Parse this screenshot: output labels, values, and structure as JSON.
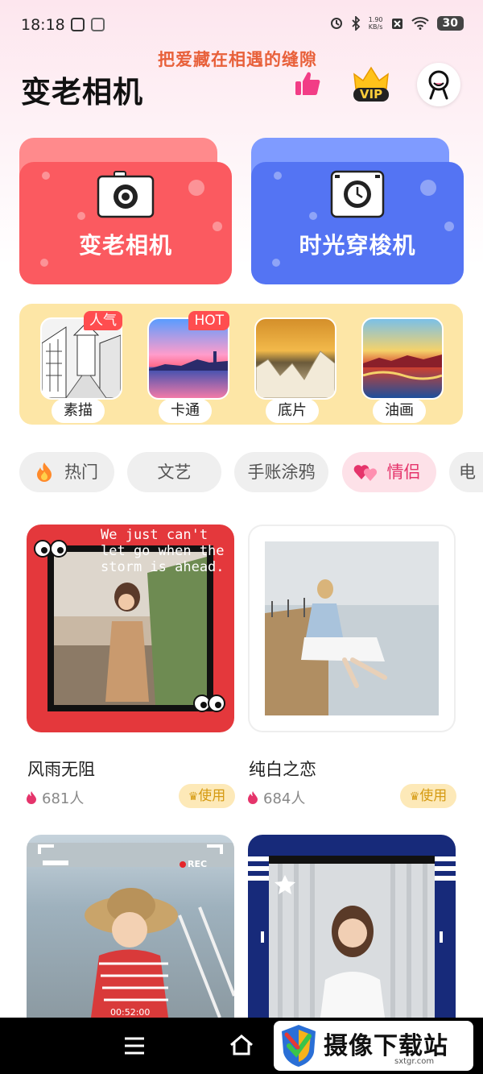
{
  "status_bar": {
    "time": "18:18",
    "net_speed_value": "1.90",
    "net_speed_unit": "KB/s",
    "battery": "30",
    "icons": [
      "alarm-icon",
      "bluetooth-icon",
      "sim-off-icon",
      "wifi-icon",
      "battery-icon"
    ]
  },
  "header": {
    "slogan": "把爱藏在相遇的缝隙",
    "title": "变老相机",
    "vip_label": "VIP"
  },
  "big_cards": [
    {
      "label": "变老相机",
      "color": "#fb5a60",
      "icon": "camera-icon"
    },
    {
      "label": "时光穿梭机",
      "color": "#5474f3",
      "icon": "clock-camera-icon"
    }
  ],
  "filters": [
    {
      "label": "素描",
      "badge": "人气"
    },
    {
      "label": "卡通",
      "badge": "HOT"
    },
    {
      "label": "底片",
      "badge": ""
    },
    {
      "label": "油画",
      "badge": ""
    }
  ],
  "categories": [
    {
      "label": "热门",
      "icon": "flame-icon"
    },
    {
      "label": "文艺"
    },
    {
      "label": "手账涂鸦"
    },
    {
      "label": "情侣",
      "icon": "hearts-icon",
      "selected": true
    },
    {
      "label": "电"
    }
  ],
  "templates": [
    {
      "name": "风雨无阻",
      "count": "681人",
      "use_label": "使用",
      "frame_text": "We just can't let go when the storm is ahead."
    },
    {
      "name": "纯白之恋",
      "count": "684人",
      "use_label": "使用"
    },
    {
      "rec_label": "REC",
      "timer": "00:52:00"
    },
    {}
  ],
  "watermark": {
    "text": "摄像下载站",
    "url": "sxtgr.com"
  },
  "colors": {
    "accent_pink": "#e5346b",
    "red_card": "#fb5a60",
    "blue_card": "#5474f3",
    "panel_yellow": "#fde6a6",
    "use_gold": "#d59a12"
  }
}
